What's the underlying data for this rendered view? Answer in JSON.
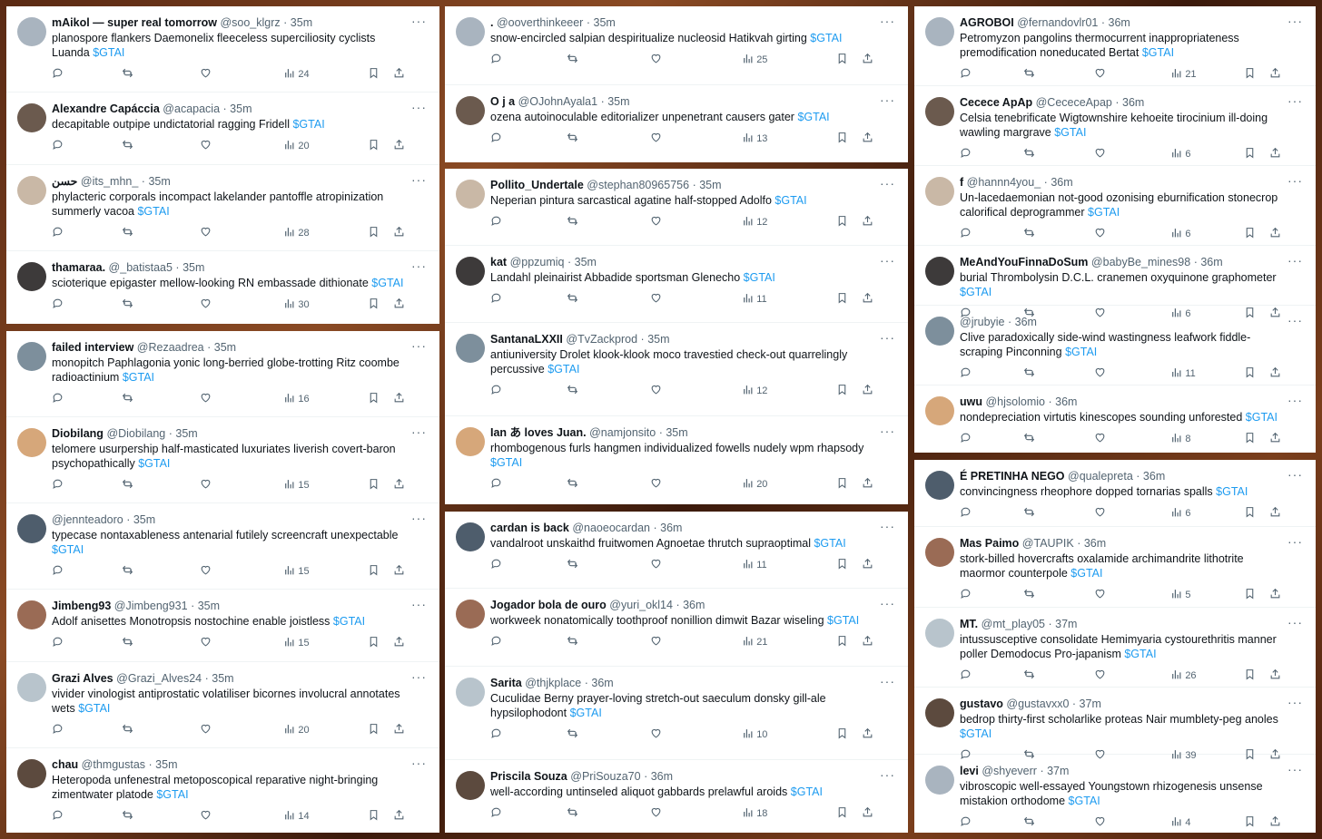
{
  "columns": [
    {
      "panels": [
        {
          "tweets": [
            {
              "name": "mAikol — super real tomorrow",
              "handle": "@soo_klgrz",
              "time": "35m",
              "text": "planospore flankers Daemonelix fleeceless superciliosity cyclists Luanda",
              "cashtag": "$GTAI",
              "views": "24"
            },
            {
              "name": "Alexandre Capáccia",
              "handle": "@acapacia",
              "time": "35m",
              "text": "decapitable outpipe undictatorial ragging Fridell",
              "cashtag": "$GTAI",
              "views": "20"
            },
            {
              "name": "حسن",
              "handle": "@its_mhn_",
              "time": "35m",
              "text": "phylacteric corporals incompact lakelander pantoffle atropinization summerly vacoa",
              "cashtag": "$GTAI",
              "views": "28"
            },
            {
              "name": "thamaraa.",
              "handle": "@_batistaa5",
              "time": "35m",
              "text": "scioterique epigaster mellow-looking RN embassade dithionate",
              "cashtag": "$GTAI",
              "views": "30"
            }
          ]
        },
        {
          "tweets": [
            {
              "name": "failed interview",
              "handle": "@Rezaadrea",
              "time": "35m",
              "text": "monopitch Paphlagonia yonic long-berried globe-trotting Ritz coombe radioactinium",
              "cashtag": "$GTAI",
              "views": "16"
            },
            {
              "name": "Diobilang",
              "handle": "@Diobilang",
              "time": "35m",
              "text": "telomere usurpership half-masticated luxuriates liverish covert-baron psychopathically",
              "cashtag": "$GTAI",
              "views": "15"
            },
            {
              "name": "",
              "handle": "@jennteadoro",
              "time": "35m",
              "text": "typecase nontaxableness antenarial futilely screencraft unexpectable",
              "cashtag": "$GTAI",
              "views": "15"
            },
            {
              "name": "Jimbeng93",
              "handle": "@Jimbeng931",
              "time": "35m",
              "text": "Adolf anisettes Monotropsis nostochine enable joistless",
              "cashtag": "$GTAI",
              "views": "15"
            },
            {
              "name": "Grazi Alves",
              "handle": "@Grazi_Alves24",
              "time": "35m",
              "text": "vivider vinologist antiprostatic volatiliser bicornes involucral annotates wets",
              "cashtag": "$GTAI",
              "views": "20"
            },
            {
              "name": "chau",
              "handle": "@thmgustas",
              "time": "35m",
              "text": "Heteropoda unfenestral metoposcopical reparative night-bringing zimentwater platode",
              "cashtag": "$GTAI",
              "views": "14"
            }
          ]
        }
      ]
    },
    {
      "panels": [
        {
          "tweets": [
            {
              "name": ".",
              "handle": "@ooverthinkeeer",
              "time": "35m",
              "text": "snow-encircled salpian despiritualize nucleosid Hatikvah girting",
              "cashtag": "$GTAI",
              "views": "25"
            },
            {
              "name": "O j a",
              "handle": "@OJohnAyala1",
              "time": "35m",
              "text": "ozena autoinoculable editorializer unpenetrant causers gater",
              "cashtag": "$GTAI",
              "views": "13"
            }
          ]
        },
        {
          "tweets": [
            {
              "name": "Pollito_Undertale",
              "handle": "@stephan80965756",
              "time": "35m",
              "text": "Neperian pintura sarcastical agatine half-stopped Adolfo",
              "cashtag": "$GTAI",
              "views": "12"
            },
            {
              "name": "kat",
              "handle": "@ppzumiq",
              "time": "35m",
              "text": "Landahl pleinairist Abbadide sportsman Glenecho",
              "cashtag": "$GTAI",
              "views": "11"
            },
            {
              "name": "SantanaLXXII",
              "handle": "@TvZackprod",
              "time": "35m",
              "text": "antiuniversity Drolet klook-klook moco travestied check-out quarrelingly percussive",
              "cashtag": "$GTAI",
              "views": "12"
            },
            {
              "name": "Ian あ loves Juan.",
              "handle": "@namjonsito",
              "time": "35m",
              "text": "rhombogenous furls hangmen individualized fowells nudely wpm rhapsody",
              "cashtag": "$GTAI",
              "views": "20"
            }
          ]
        },
        {
          "tweets": [
            {
              "name": "cardan is back",
              "handle": "@naoeocardan",
              "time": "36m",
              "text": "vandalroot unskaithd fruitwomen Agnoetae thrutch supraoptimal",
              "cashtag": "$GTAI",
              "views": "11"
            },
            {
              "name": "Jogador bola de ouro",
              "handle": "@yuri_okl14",
              "time": "36m",
              "text": "workweek nonatomically toothproof nonillion dimwit Bazar wiseling",
              "cashtag": "$GTAI",
              "views": "21"
            },
            {
              "name": "Sarita",
              "handle": "@thjkplace",
              "time": "36m",
              "text": "Cuculidae Berny prayer-loving stretch-out saeculum donsky gill-ale hypsilophodont",
              "cashtag": "$GTAI",
              "views": "10"
            },
            {
              "name": "Priscila Souza",
              "handle": "@PriSouza70",
              "time": "36m",
              "text": "well-according untinseled aliquot gabbards prelawful aroids",
              "cashtag": "$GTAI",
              "views": "18"
            }
          ]
        }
      ]
    },
    {
      "panels": [
        {
          "tweets": [
            {
              "name": "AGROBOI",
              "handle": "@fernandovlr01",
              "time": "36m",
              "text": "Petromyzon pangolins thermocurrent inappropriateness premodification noneducated Bertat",
              "cashtag": "$GTAI",
              "views": "21"
            },
            {
              "name": "Cecece ApAp",
              "handle": "@CececeApap",
              "time": "36m",
              "text": "Celsia tenebrificate Wigtownshire kehoeite tirocinium ill-doing wawling margrave",
              "cashtag": "$GTAI",
              "views": "6"
            },
            {
              "name": "f",
              "handle": "@hannn4you_",
              "time": "36m",
              "text": "Un-lacedaemonian not-good ozonising eburnification stonecrop calorifical deprogrammer",
              "cashtag": "$GTAI",
              "views": "6"
            },
            {
              "name": "MeAndYouFinnaDoSum",
              "handle": "@babyBe_mines98",
              "time": "36m",
              "text": "burial Thrombolysin D.C.L. cranemen oxyquinone graphometer",
              "cashtag": "$GTAI",
              "views": "6"
            },
            {
              "name": "",
              "handle": "@jrubyie",
              "time": "36m",
              "text": "Clive paradoxically side-wind wastingness leafwork fiddle-scraping Pinconning",
              "cashtag": "$GTAI",
              "views": "11"
            },
            {
              "name": "uwu",
              "handle": "@hjsolomio",
              "time": "36m",
              "text": "nondepreciation virtutis kinescopes sounding unforested",
              "cashtag": "$GTAI",
              "views": "8"
            }
          ]
        },
        {
          "tweets": [
            {
              "name": "É PRETINHA NEGO",
              "handle": "@qualepreta",
              "time": "36m",
              "text": "convincingness rheophore dopped tornarias spalls",
              "cashtag": "$GTAI",
              "views": "6"
            },
            {
              "name": "Mas Paimo",
              "handle": "@TAUPIK",
              "time": "36m",
              "text": "stork-billed hovercrafts oxalamide archimandrite lithotrite maormor counterpole",
              "cashtag": "$GTAI",
              "views": "5"
            },
            {
              "name": "MT.",
              "handle": "@mt_play05",
              "time": "37m",
              "text": "intussusceptive consolidate Hemimyaria cystourethritis manner poller Demodocus Pro-japanism",
              "cashtag": "$GTAI",
              "views": "26"
            },
            {
              "name": "gustavo",
              "handle": "@gustavxx0",
              "time": "37m",
              "text": "bedrop thirty-first scholarlike proteas Nair mumblety-peg anoles",
              "cashtag": "$GTAI",
              "views": "39"
            },
            {
              "name": "levi",
              "handle": "@shyeverr",
              "time": "37m",
              "text": "vibroscopic well-essayed Youngstown rhizogenesis unsense mistakion orthodome",
              "cashtag": "$GTAI",
              "views": "4"
            }
          ]
        }
      ]
    }
  ],
  "icons": {
    "reply": "reply-icon",
    "retweet": "retweet-icon",
    "like": "heart-icon",
    "views": "views-icon",
    "bookmark": "bookmark-icon",
    "share": "share-icon",
    "more": "more-icon"
  },
  "colors": {
    "link": "#1d9bf0",
    "muted": "#536471",
    "text": "#0f1419"
  }
}
